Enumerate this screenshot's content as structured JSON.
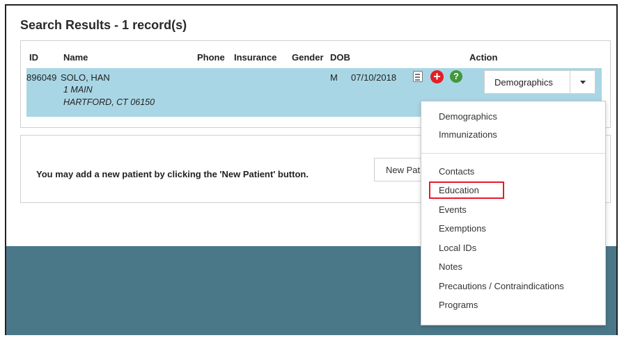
{
  "title": "Search Results - 1 record(s)",
  "columns": {
    "id": "ID",
    "name": "Name",
    "phone": "Phone",
    "insurance": "Insurance",
    "gender": "Gender",
    "dob": "DOB",
    "action": "Action"
  },
  "record": {
    "id": "896049",
    "name": "SOLO, HAN",
    "address_line1": "1 MAIN",
    "address_line2": "HARTFORD, CT 06150",
    "phone": "",
    "insurance": "",
    "gender": "M",
    "dob": "07/10/2018",
    "action_selected": "Demographics"
  },
  "icons": {
    "add_glyph": "+",
    "help_glyph": "?"
  },
  "new_patient": {
    "message": "You may add a new patient by clicking the 'New Patient' button.",
    "button_label": "New Patient"
  },
  "action_menu": {
    "group1": [
      "Demographics",
      "Immunizations"
    ],
    "group2": [
      "Contacts",
      "Education",
      "Events",
      "Exemptions",
      "Local IDs",
      "Notes",
      "Precautions / Contraindications",
      "Programs"
    ]
  },
  "colors": {
    "row_highlight": "#a9d6e5",
    "footer_band": "#4b7889",
    "callout_border": "#e8182a",
    "add_icon": "#e31e24",
    "help_icon": "#3f9a3a"
  }
}
